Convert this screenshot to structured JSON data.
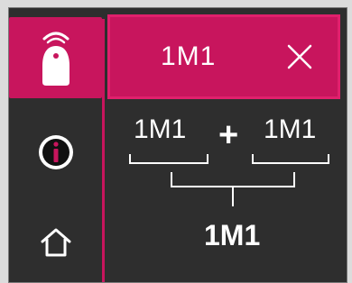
{
  "header": {
    "title": "1M1"
  },
  "sidebar": {
    "items": [
      {
        "icon": "hanger-tag-icon",
        "active": true
      },
      {
        "icon": "info-icon",
        "active": false
      },
      {
        "icon": "home-icon",
        "active": false
      }
    ]
  },
  "formula": {
    "left_term": "1M1",
    "operator": "+",
    "right_term": "1M1",
    "result": "1M1"
  },
  "colors": {
    "accent": "#c8155d",
    "background": "#2e2e2e",
    "text": "#ffffff"
  }
}
